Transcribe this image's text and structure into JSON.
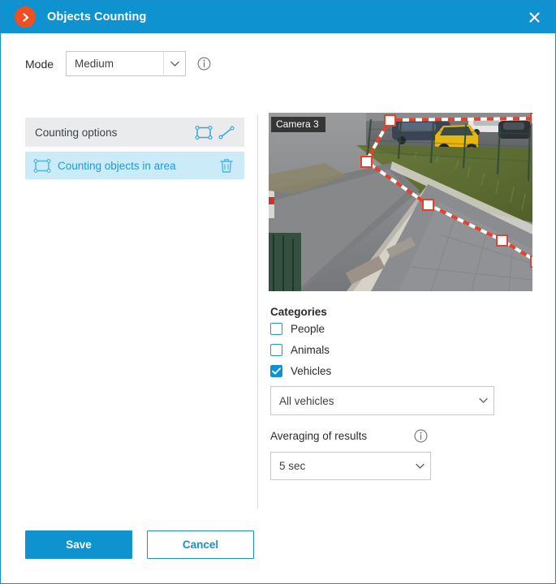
{
  "titlebar": {
    "title": "Objects Counting",
    "badge_icon": "chevron-right-icon",
    "badge_color": "#f04e23",
    "bar_color": "#0f92d0",
    "close_icon": "close-icon"
  },
  "mode": {
    "label": "Mode",
    "value": "Medium",
    "info_icon": "info-icon",
    "chevron_icon": "chevron-down-icon"
  },
  "counting_options": {
    "header": "Counting options",
    "area_tool_icon": "draw-area-icon",
    "line_tool_icon": "draw-line-icon",
    "items": [
      {
        "label": "Counting objects in area",
        "icon": "area-icon",
        "delete_icon": "trash-icon",
        "selected": true
      }
    ]
  },
  "preview": {
    "camera_label": "Camera 3",
    "overlay_color": "#e8402a",
    "handle_count": 6
  },
  "categories": {
    "title": "Categories",
    "items": [
      {
        "label": "People",
        "checked": false
      },
      {
        "label": "Animals",
        "checked": false
      },
      {
        "label": "Vehicles",
        "checked": true
      }
    ],
    "vehicles_select": {
      "value": "All vehicles",
      "chevron_icon": "chevron-down-icon"
    }
  },
  "averaging": {
    "label": "Averaging of results",
    "info_icon": "info-icon",
    "value": "5 sec",
    "chevron_icon": "chevron-down-icon"
  },
  "footer": {
    "save_label": "Save",
    "cancel_label": "Cancel"
  },
  "colors": {
    "accent": "#0f92d0",
    "accent_light": "#1f9ad6",
    "selected_row": "#ccebf8",
    "header_row": "#e9ebed",
    "badge_orange": "#f04e23",
    "overlay_red": "#e8402a"
  }
}
